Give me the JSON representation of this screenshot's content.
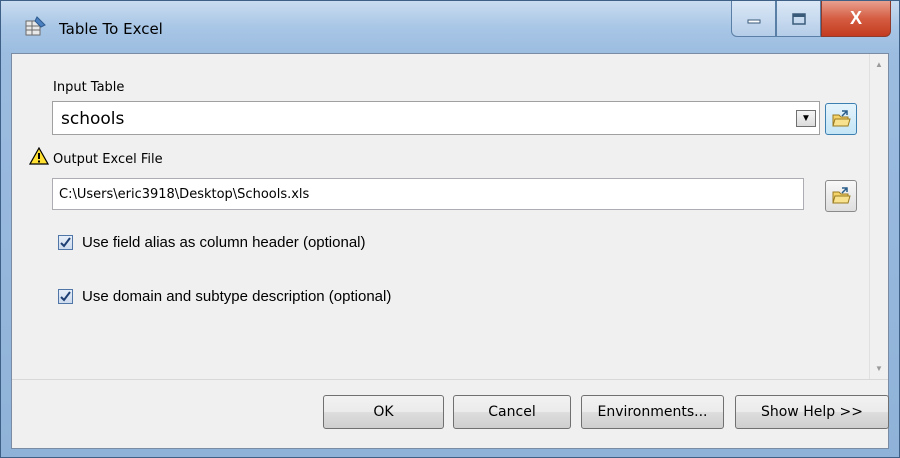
{
  "window": {
    "title": "Table To Excel",
    "minimize_icon": "minimize-icon",
    "maximize_icon": "maximize-icon",
    "close_label": "X"
  },
  "form": {
    "input_table": {
      "label": "Input Table",
      "value": "schools"
    },
    "output_excel": {
      "label": "Output Excel File",
      "value": "C:\\Users\\eric3918\\Desktop\\Schools.xls",
      "warning_icon": "warning-icon"
    },
    "options": [
      {
        "label": "Use field alias as column header (optional)",
        "checked": true
      },
      {
        "label": "Use domain and subtype description (optional)",
        "checked": true
      }
    ]
  },
  "buttons": {
    "ok": "OK",
    "cancel": "Cancel",
    "environments": "Environments...",
    "show_help": "Show Help >>"
  },
  "colors": {
    "accent": "#3c7fb1",
    "close_button": "#c43b20"
  }
}
